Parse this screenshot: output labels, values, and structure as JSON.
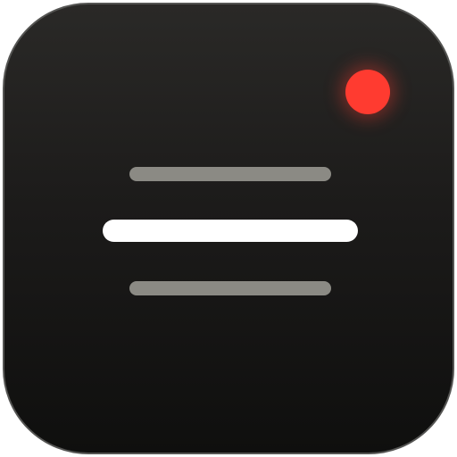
{
  "icon": {
    "name": "menu-icon",
    "background_top": "#2a2927",
    "background_bottom": "#0f0f0e",
    "border_color": "#555553"
  },
  "lines": {
    "top_color": "#8b8a84",
    "middle_color": "#ffffff",
    "bottom_color": "#8b8a84"
  },
  "badge": {
    "name": "notification-dot",
    "color": "#ff3b30",
    "glow_color": "rgba(255,59,48,0.35)"
  }
}
